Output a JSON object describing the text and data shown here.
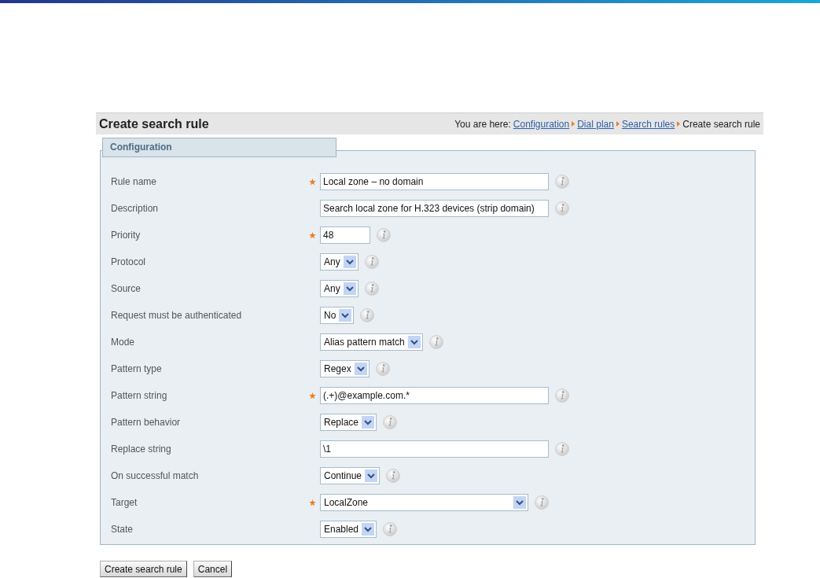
{
  "page_title": "Create search rule",
  "breadcrumb": {
    "prefix": "You are here:",
    "links": [
      "Configuration",
      "Dial plan",
      "Search rules"
    ],
    "current": "Create search rule"
  },
  "section": {
    "legend": "Configuration"
  },
  "fields": [
    {
      "label": "Rule name",
      "kind": "text",
      "required": true,
      "value": "Local zone – no domain"
    },
    {
      "label": "Description",
      "kind": "text",
      "required": false,
      "value": "Search local zone for H.323 devices (strip domain)"
    },
    {
      "label": "Priority",
      "kind": "number",
      "required": true,
      "value": "48"
    },
    {
      "label": "Protocol",
      "kind": "select",
      "required": false,
      "value": "Any"
    },
    {
      "label": "Source",
      "kind": "select",
      "required": false,
      "value": "Any"
    },
    {
      "label": "Request must be authenticated",
      "kind": "select",
      "required": false,
      "value": "No"
    },
    {
      "label": "Mode",
      "kind": "select",
      "required": false,
      "value": "Alias pattern match"
    },
    {
      "label": "Pattern type",
      "kind": "select",
      "required": false,
      "value": "Regex"
    },
    {
      "label": "Pattern string",
      "kind": "text",
      "required": true,
      "value": "(.+)@example.com.*"
    },
    {
      "label": "Pattern behavior",
      "kind": "select",
      "required": false,
      "value": "Replace"
    },
    {
      "label": "Replace string",
      "kind": "text",
      "required": false,
      "value": "\\1"
    },
    {
      "label": "On successful match",
      "kind": "select",
      "required": false,
      "value": "Continue"
    },
    {
      "label": "Target",
      "kind": "wide_select",
      "required": true,
      "value": "LocalZone"
    },
    {
      "label": "State",
      "kind": "select",
      "required": false,
      "value": "Enabled"
    }
  ],
  "buttons": [
    "Create search rule",
    "Cancel"
  ]
}
